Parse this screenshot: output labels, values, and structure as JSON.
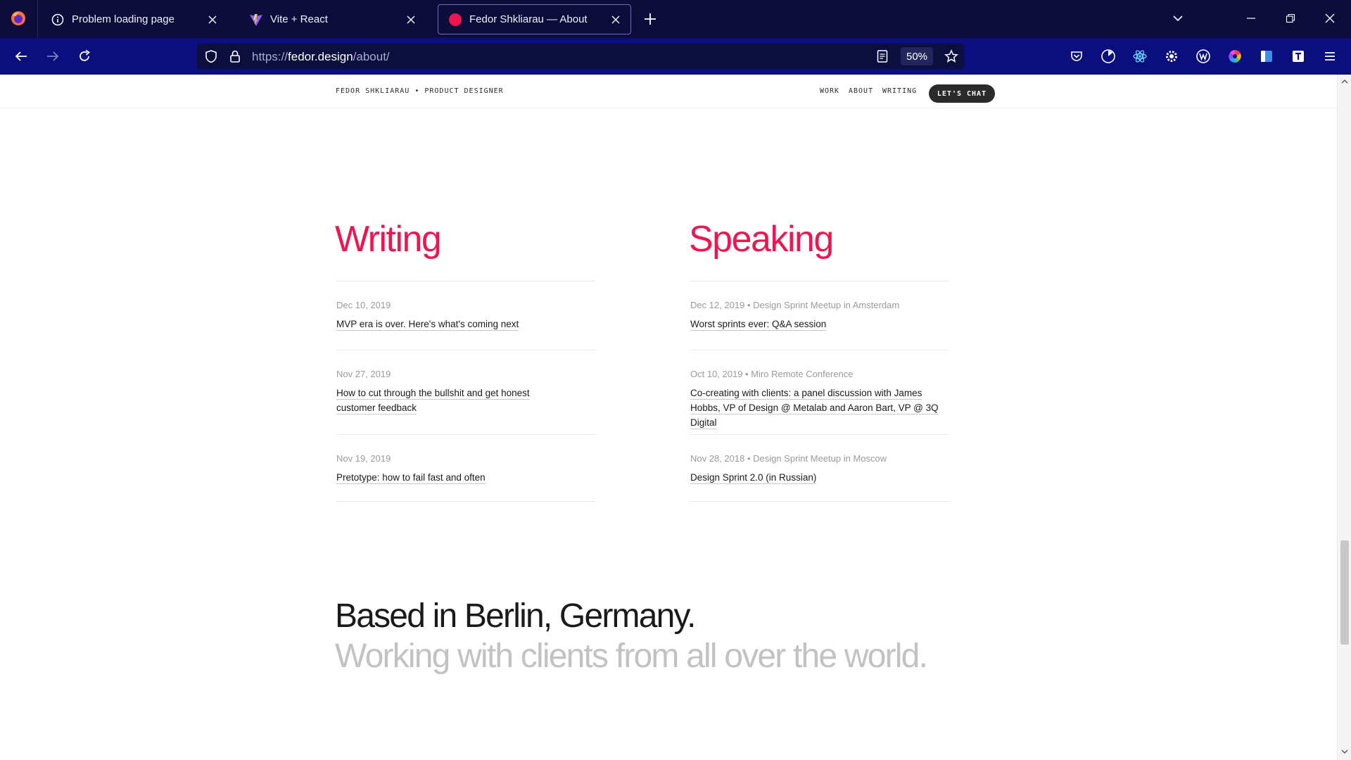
{
  "browser": {
    "tabs": [
      {
        "title": "Problem loading page",
        "icon": "info-icon"
      },
      {
        "title": "Vite + React",
        "icon": "vite-icon"
      },
      {
        "title": "Fedor Shkliarau — About",
        "icon": "site-favicon",
        "active": true
      }
    ],
    "url": {
      "scheme": "https://",
      "host": "fedor.design",
      "path": "/about/"
    },
    "zoom": "50%",
    "extensions": [
      "pocket-icon",
      "timer-icon",
      "react-devtools-icon",
      "settings-gear-icon",
      "w-extension-icon",
      "color-wheel-icon",
      "sidebar-icon",
      "t-extension-icon",
      "hamburger-menu-icon"
    ]
  },
  "site": {
    "brand": "FEDOR SHKLIARAU • PRODUCT DESIGNER",
    "nav": {
      "work": "WORK",
      "about": "ABOUT",
      "writing": "WRITING",
      "cta": "LET'S CHAT"
    }
  },
  "writing": {
    "title": "Writing",
    "items": [
      {
        "meta": "Dec 10, 2019",
        "title": "MVP era is over. Here's what's coming next"
      },
      {
        "meta": "Nov 27, 2019",
        "title": "How to cut through the bullshit and get honest customer feedback"
      },
      {
        "meta": "Nov 19, 2019",
        "title": "Pretotype: how to fail fast and often"
      }
    ]
  },
  "speaking": {
    "title": "Speaking",
    "items": [
      {
        "meta": "Dec 12, 2019 • Design Sprint Meetup in Amsterdam",
        "title": "Worst sprints ever: Q&A session"
      },
      {
        "meta": "Oct 10, 2019 • Miro Remote Conference",
        "title": "Co-creating with clients: a panel discussion with James Hobbs, VP of Design @ Metalab and Aaron Bart, VP @ 3Q Digital"
      },
      {
        "meta": "Nov 28, 2018 • Design Sprint Meetup in Moscow",
        "title": "Design Sprint 2.0 (in Russian)"
      }
    ]
  },
  "location": {
    "headline": "Based in Berlin, Germany.",
    "subline": "Working with clients from all over the world."
  },
  "colors": {
    "accent": "#f0154f",
    "chrome_dark": "#0c0d3b",
    "chrome_nav": "#0a0e7e"
  }
}
